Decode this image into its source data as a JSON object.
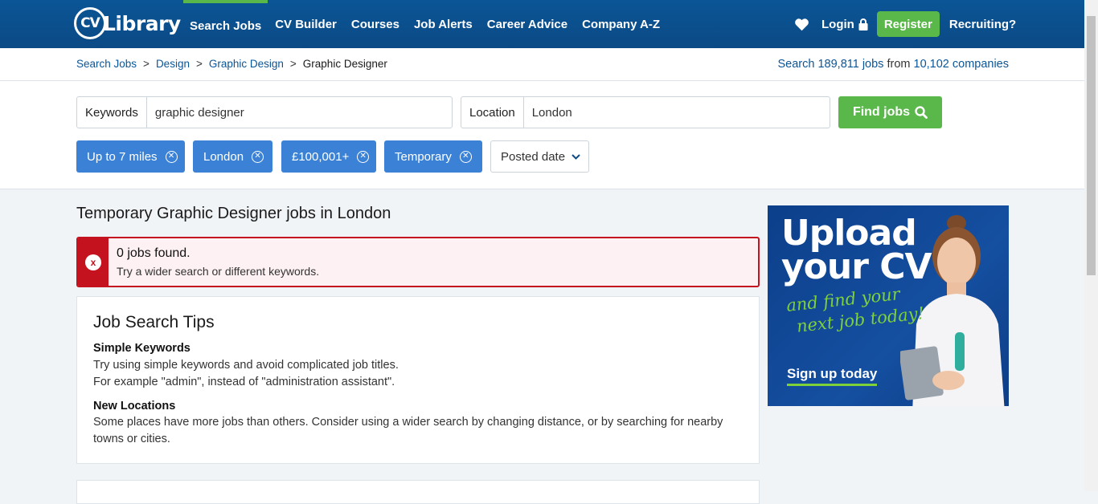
{
  "header": {
    "logo": "CV Library",
    "nav": [
      {
        "label": "Search Jobs",
        "active": true
      },
      {
        "label": "CV Builder"
      },
      {
        "label": "Courses"
      },
      {
        "label": "Job Alerts"
      },
      {
        "label": "Career Advice"
      },
      {
        "label": "Company A-Z"
      }
    ],
    "login": "Login",
    "register": "Register",
    "recruiting": "Recruiting?"
  },
  "breadcrumb": {
    "items": [
      "Search Jobs",
      "Design",
      "Graphic Design"
    ],
    "current": "Graphic Designer"
  },
  "stats": {
    "prefix": "Search",
    "jobs": "189,811 jobs",
    "middle": "from",
    "companies": "10,102 companies"
  },
  "search": {
    "keywords_label": "Keywords",
    "keywords_value": "graphic designer",
    "location_label": "Location",
    "location_value": "London",
    "find_button": "Find jobs"
  },
  "filters": [
    "Up to 7 miles",
    "London",
    "£100,001+",
    "Temporary"
  ],
  "sort": {
    "label": "Posted date"
  },
  "results": {
    "title": "Temporary Graphic Designer jobs in London",
    "alert_title": "0 jobs found.",
    "alert_text": "Try a wider search or different keywords."
  },
  "tips": {
    "title": "Job Search Tips",
    "items": [
      {
        "heading": "Simple Keywords",
        "text": [
          "Try using simple keywords and avoid complicated job titles.",
          "For example \"admin\", instead of \"administration assistant\"."
        ]
      },
      {
        "heading": "New Locations",
        "text": [
          "Some places have more jobs than others. Consider using a wider search by changing distance, or by searching for nearby",
          "towns or cities."
        ]
      }
    ]
  },
  "ad": {
    "headline": [
      "Upload",
      "your CV"
    ],
    "sub": [
      "and find your",
      "next job today!"
    ],
    "cta": "Sign up today"
  },
  "colors": {
    "primary": "#0b5596",
    "accent_green": "#5ab84a",
    "chip_blue": "#3b82d6",
    "error_red": "#c4121f"
  }
}
